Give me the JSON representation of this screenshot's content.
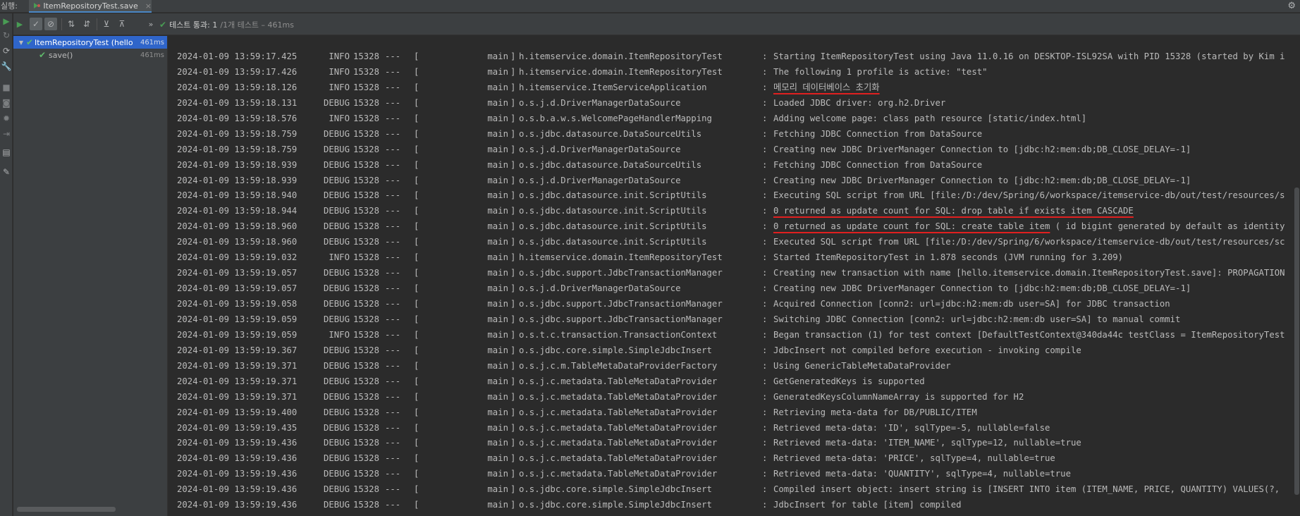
{
  "window": {
    "run_label": "실행:",
    "tab_label": "ItemRepositoryTest.save",
    "tab_close": "×",
    "settings_icon": "gear-icon"
  },
  "toolbar": {
    "status_check": "✔",
    "status_passed": "테스트 통과: 1",
    "status_detail": "/1개 테스트 – 461ms",
    "more": "»"
  },
  "tree": {
    "items": [
      {
        "arrow": "▼",
        "check": "✔",
        "name": "ItemRepositoryTest (hello",
        "time": "461ms"
      },
      {
        "check": "✔",
        "name": "save()",
        "time": "461ms"
      }
    ]
  },
  "console": {
    "lines": [
      {
        "date": "2024-01-09 13:59:17.425",
        "level": "INFO",
        "pid": "15328",
        "sep": "---",
        "thread": "main",
        "logger": "h.itemservice.domain.ItemRepositoryTest",
        "message": "Starting ItemRepositoryTest using Java 11.0.16 on DESKTOP-ISL92SA with PID 15328 (started by Kim i"
      },
      {
        "date": "2024-01-09 13:59:17.426",
        "level": "INFO",
        "pid": "15328",
        "sep": "---",
        "thread": "main",
        "logger": "h.itemservice.domain.ItemRepositoryTest",
        "message": "The following 1 profile is active: \"test\""
      },
      {
        "date": "2024-01-09 13:59:18.126",
        "level": "INFO",
        "pid": "15328",
        "sep": "---",
        "thread": "main",
        "logger": "h.itemservice.ItemServiceApplication",
        "message": "메모리 데이터베이스 초기화",
        "underline": true
      },
      {
        "date": "2024-01-09 13:59:18.131",
        "level": "DEBUG",
        "pid": "15328",
        "sep": "---",
        "thread": "main",
        "logger": "o.s.j.d.DriverManagerDataSource",
        "message": "Loaded JDBC driver: org.h2.Driver"
      },
      {
        "date": "2024-01-09 13:59:18.576",
        "level": "INFO",
        "pid": "15328",
        "sep": "---",
        "thread": "main",
        "logger": "o.s.b.a.w.s.WelcomePageHandlerMapping",
        "message": "Adding welcome page: class path resource [static/index.html]"
      },
      {
        "date": "2024-01-09 13:59:18.759",
        "level": "DEBUG",
        "pid": "15328",
        "sep": "---",
        "thread": "main",
        "logger": "o.s.jdbc.datasource.DataSourceUtils",
        "message": "Fetching JDBC Connection from DataSource"
      },
      {
        "date": "2024-01-09 13:59:18.759",
        "level": "DEBUG",
        "pid": "15328",
        "sep": "---",
        "thread": "main",
        "logger": "o.s.j.d.DriverManagerDataSource",
        "message": "Creating new JDBC DriverManager Connection to [jdbc:h2:mem:db;DB_CLOSE_DELAY=-1]"
      },
      {
        "date": "2024-01-09 13:59:18.939",
        "level": "DEBUG",
        "pid": "15328",
        "sep": "---",
        "thread": "main",
        "logger": "o.s.jdbc.datasource.DataSourceUtils",
        "message": "Fetching JDBC Connection from DataSource"
      },
      {
        "date": "2024-01-09 13:59:18.939",
        "level": "DEBUG",
        "pid": "15328",
        "sep": "---",
        "thread": "main",
        "logger": "o.s.j.d.DriverManagerDataSource",
        "message": "Creating new JDBC DriverManager Connection to [jdbc:h2:mem:db;DB_CLOSE_DELAY=-1]"
      },
      {
        "date": "2024-01-09 13:59:18.940",
        "level": "DEBUG",
        "pid": "15328",
        "sep": "---",
        "thread": "main",
        "logger": "o.s.jdbc.datasource.init.ScriptUtils",
        "message": "Executing SQL script from URL [file:/D:/dev/Spring/6/workspace/itemservice-db/out/test/resources/s"
      },
      {
        "date": "2024-01-09 13:59:18.944",
        "level": "DEBUG",
        "pid": "15328",
        "sep": "---",
        "thread": "main",
        "logger": "o.s.jdbc.datasource.init.ScriptUtils",
        "message": "0 returned as update count for SQL: drop table if exists item CASCADE",
        "underline": true
      },
      {
        "date": "2024-01-09 13:59:18.960",
        "level": "DEBUG",
        "pid": "15328",
        "sep": "---",
        "thread": "main",
        "logger": "o.s.jdbc.datasource.init.ScriptUtils",
        "message": "0 returned as update count for SQL: create table item ( id bigint generated by default as identity",
        "underline_part": "0 returned as update count for SQL: create table item",
        "rest": " ( id bigint generated by default as identity"
      },
      {
        "date": "2024-01-09 13:59:18.960",
        "level": "DEBUG",
        "pid": "15328",
        "sep": "---",
        "thread": "main",
        "logger": "o.s.jdbc.datasource.init.ScriptUtils",
        "message": "Executed SQL script from URL [file:/D:/dev/Spring/6/workspace/itemservice-db/out/test/resources/sc"
      },
      {
        "date": "2024-01-09 13:59:19.032",
        "level": "INFO",
        "pid": "15328",
        "sep": "---",
        "thread": "main",
        "logger": "h.itemservice.domain.ItemRepositoryTest",
        "message": "Started ItemRepositoryTest in 1.878 seconds (JVM running for 3.209)"
      },
      {
        "date": "2024-01-09 13:59:19.057",
        "level": "DEBUG",
        "pid": "15328",
        "sep": "---",
        "thread": "main",
        "logger": "o.s.jdbc.support.JdbcTransactionManager",
        "message": "Creating new transaction with name [hello.itemservice.domain.ItemRepositoryTest.save]: PROPAGATION"
      },
      {
        "date": "2024-01-09 13:59:19.057",
        "level": "DEBUG",
        "pid": "15328",
        "sep": "---",
        "thread": "main",
        "logger": "o.s.j.d.DriverManagerDataSource",
        "message": "Creating new JDBC DriverManager Connection to [jdbc:h2:mem:db;DB_CLOSE_DELAY=-1]"
      },
      {
        "date": "2024-01-09 13:59:19.058",
        "level": "DEBUG",
        "pid": "15328",
        "sep": "---",
        "thread": "main",
        "logger": "o.s.jdbc.support.JdbcTransactionManager",
        "message": "Acquired Connection [conn2: url=jdbc:h2:mem:db user=SA] for JDBC transaction"
      },
      {
        "date": "2024-01-09 13:59:19.059",
        "level": "DEBUG",
        "pid": "15328",
        "sep": "---",
        "thread": "main",
        "logger": "o.s.jdbc.support.JdbcTransactionManager",
        "message": "Switching JDBC Connection [conn2: url=jdbc:h2:mem:db user=SA] to manual commit"
      },
      {
        "date": "2024-01-09 13:59:19.059",
        "level": "INFO",
        "pid": "15328",
        "sep": "---",
        "thread": "main",
        "logger": "o.s.t.c.transaction.TransactionContext",
        "message": "Began transaction (1) for test context [DefaultTestContext@340da44c testClass = ItemRepositoryTest"
      },
      {
        "date": "2024-01-09 13:59:19.367",
        "level": "DEBUG",
        "pid": "15328",
        "sep": "---",
        "thread": "main",
        "logger": "o.s.jdbc.core.simple.SimpleJdbcInsert",
        "message": "JdbcInsert not compiled before execution - invoking compile"
      },
      {
        "date": "2024-01-09 13:59:19.371",
        "level": "DEBUG",
        "pid": "15328",
        "sep": "---",
        "thread": "main",
        "logger": "o.s.j.c.m.TableMetaDataProviderFactory",
        "message": "Using GenericTableMetaDataProvider"
      },
      {
        "date": "2024-01-09 13:59:19.371",
        "level": "DEBUG",
        "pid": "15328",
        "sep": "---",
        "thread": "main",
        "logger": "o.s.j.c.metadata.TableMetaDataProvider",
        "message": "GetGeneratedKeys is supported"
      },
      {
        "date": "2024-01-09 13:59:19.371",
        "level": "DEBUG",
        "pid": "15328",
        "sep": "---",
        "thread": "main",
        "logger": "o.s.j.c.metadata.TableMetaDataProvider",
        "message": "GeneratedKeysColumnNameArray is supported for H2"
      },
      {
        "date": "2024-01-09 13:59:19.400",
        "level": "DEBUG",
        "pid": "15328",
        "sep": "---",
        "thread": "main",
        "logger": "o.s.j.c.metadata.TableMetaDataProvider",
        "message": "Retrieving meta-data for DB/PUBLIC/ITEM"
      },
      {
        "date": "2024-01-09 13:59:19.435",
        "level": "DEBUG",
        "pid": "15328",
        "sep": "---",
        "thread": "main",
        "logger": "o.s.j.c.metadata.TableMetaDataProvider",
        "message": "Retrieved meta-data: 'ID', sqlType=-5, nullable=false"
      },
      {
        "date": "2024-01-09 13:59:19.436",
        "level": "DEBUG",
        "pid": "15328",
        "sep": "---",
        "thread": "main",
        "logger": "o.s.j.c.metadata.TableMetaDataProvider",
        "message": "Retrieved meta-data: 'ITEM_NAME', sqlType=12, nullable=true"
      },
      {
        "date": "2024-01-09 13:59:19.436",
        "level": "DEBUG",
        "pid": "15328",
        "sep": "---",
        "thread": "main",
        "logger": "o.s.j.c.metadata.TableMetaDataProvider",
        "message": "Retrieved meta-data: 'PRICE', sqlType=4, nullable=true"
      },
      {
        "date": "2024-01-09 13:59:19.436",
        "level": "DEBUG",
        "pid": "15328",
        "sep": "---",
        "thread": "main",
        "logger": "o.s.j.c.metadata.TableMetaDataProvider",
        "message": "Retrieved meta-data: 'QUANTITY', sqlType=4, nullable=true"
      },
      {
        "date": "2024-01-09 13:59:19.436",
        "level": "DEBUG",
        "pid": "15328",
        "sep": "---",
        "thread": "main",
        "logger": "o.s.jdbc.core.simple.SimpleJdbcInsert",
        "message": "Compiled insert object: insert string is [INSERT INTO item (ITEM_NAME, PRICE, QUANTITY) VALUES(?,"
      },
      {
        "date": "2024-01-09 13:59:19.436",
        "level": "DEBUG",
        "pid": "15328",
        "sep": "---",
        "thread": "main",
        "logger": "o.s.jdbc.core.simple.SimpleJdbcInsert",
        "message": "JdbcInsert for table [item] compiled"
      }
    ]
  },
  "colors": {
    "pass_green": "#499c54",
    "selection_blue": "#2f65ca",
    "underline_red": "#e02020"
  }
}
